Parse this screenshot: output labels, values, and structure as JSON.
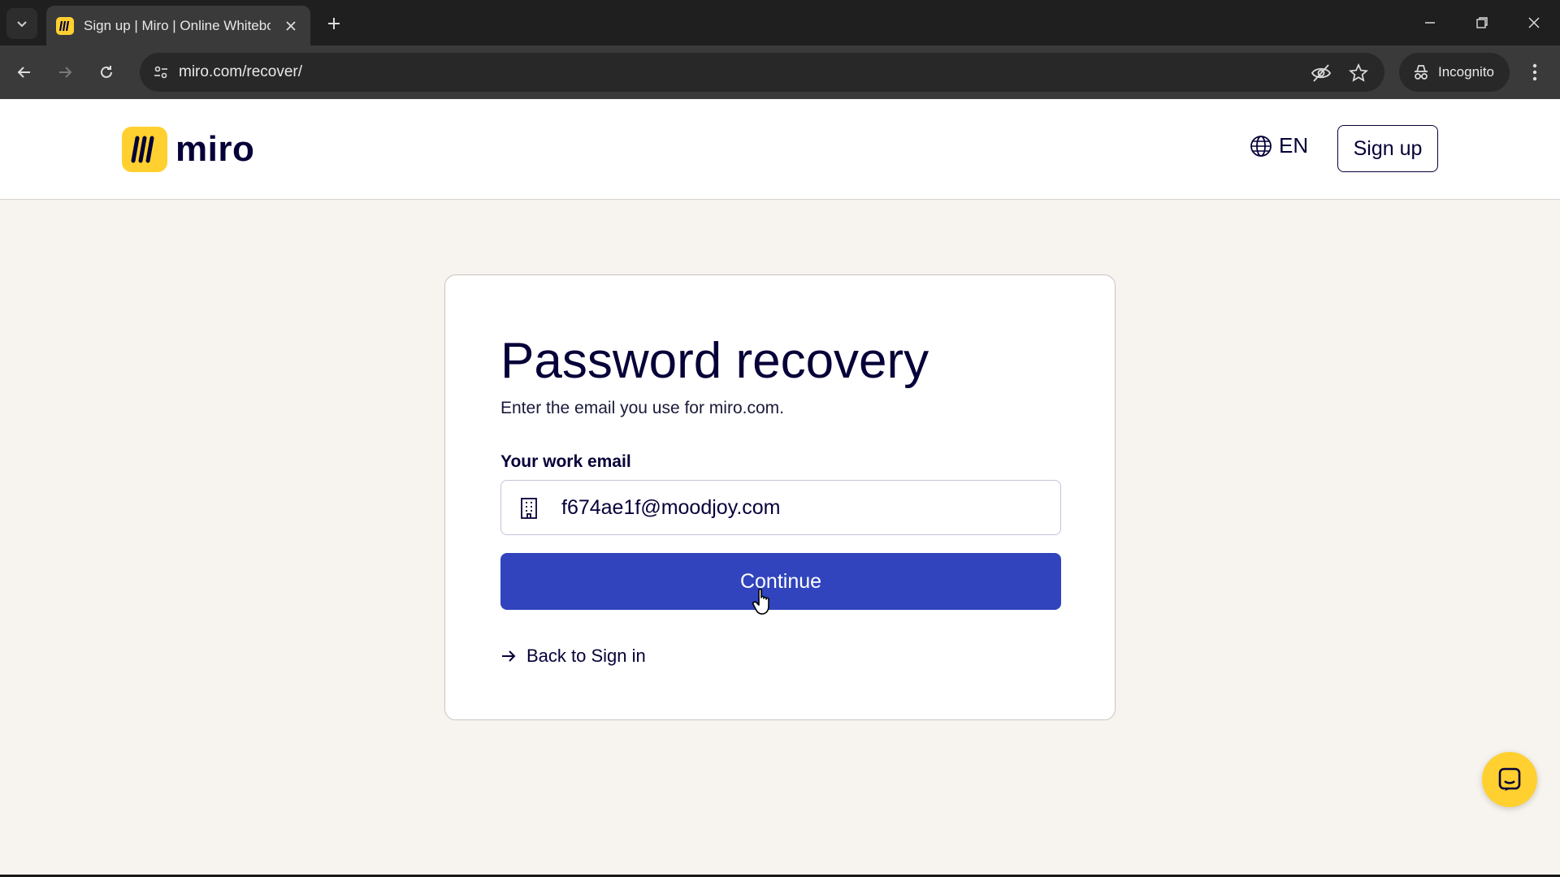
{
  "browser": {
    "tab_title": "Sign up | Miro | Online Whitebc",
    "url": "miro.com/recover/",
    "incognito_label": "Incognito"
  },
  "header": {
    "logo_text": "miro",
    "language": "EN",
    "signup_label": "Sign up"
  },
  "recovery": {
    "title": "Password recovery",
    "subtitle": "Enter the email you use for miro.com.",
    "email_label": "Your work email",
    "email_value": "f674ae1f@moodjoy.com",
    "continue_label": "Continue",
    "back_label": "Back to Sign in"
  },
  "colors": {
    "brand_yellow": "#ffd02f",
    "primary_blue": "#3144bd",
    "text_dark": "#050038",
    "page_bg": "#f7f3ee"
  },
  "icons": [
    "tab-list-icon",
    "miro-favicon-icon",
    "close-icon",
    "plus-icon",
    "minimize-icon",
    "restore-icon",
    "back-icon",
    "forward-icon",
    "reload-icon",
    "site-info-icon",
    "eye-off-icon",
    "star-icon",
    "incognito-icon",
    "more-icon",
    "globe-icon",
    "building-icon",
    "arrow-right-icon",
    "chat-icon"
  ]
}
